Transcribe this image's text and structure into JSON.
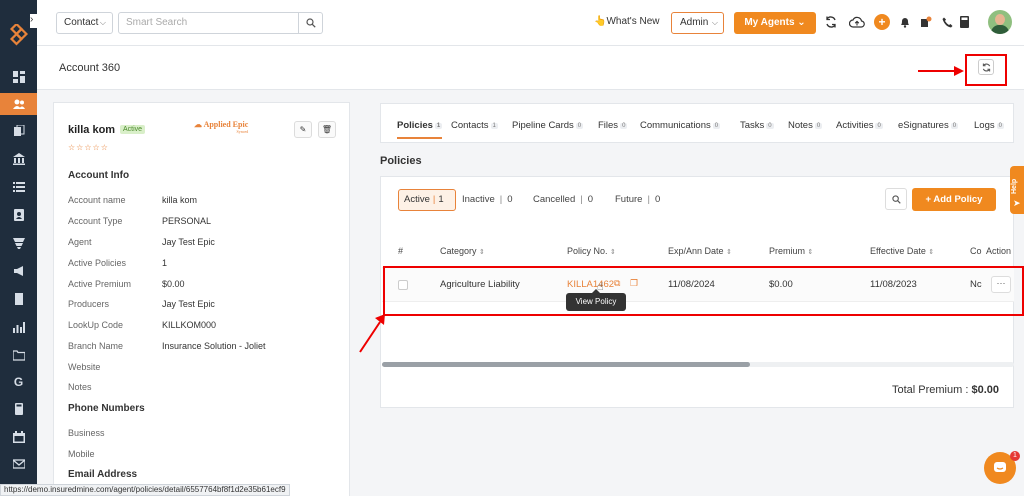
{
  "topbar": {
    "contact_select": "Contact",
    "search_placeholder": "Smart Search",
    "whats_new": "What's New",
    "admin_select": "Admin",
    "agents_button": "My Agents"
  },
  "page": {
    "title": "Account 360"
  },
  "account": {
    "name": "killa kom",
    "status": "Active",
    "integration_logo": "Applied Epic",
    "integration_sub": "Synced",
    "account_info_heading": "Account Info",
    "fields": [
      {
        "label": "Account name",
        "value": "killa kom"
      },
      {
        "label": "Account Type",
        "value": "PERSONAL"
      },
      {
        "label": "Agent",
        "value": "Jay Test Epic"
      },
      {
        "label": "Active Policies",
        "value": "1"
      },
      {
        "label": "Active Premium",
        "value": "$0.00"
      },
      {
        "label": "Producers",
        "value": "Jay Test Epic"
      },
      {
        "label": "LookUp Code",
        "value": "KILLKOM000"
      },
      {
        "label": "Branch Name",
        "value": "Insurance Solution - Joliet"
      },
      {
        "label": "Website",
        "value": ""
      },
      {
        "label": "Notes",
        "value": ""
      }
    ],
    "phone_heading": "Phone Numbers",
    "phone_fields": [
      {
        "label": "Business",
        "value": ""
      },
      {
        "label": "Mobile",
        "value": ""
      }
    ],
    "email_heading": "Email Address"
  },
  "tabs": [
    {
      "label": "Policies",
      "count": "1"
    },
    {
      "label": "Contacts",
      "count": "1"
    },
    {
      "label": "Pipeline Cards",
      "count": "0"
    },
    {
      "label": "Files",
      "count": "0"
    },
    {
      "label": "Communications",
      "count": "0"
    },
    {
      "label": "Tasks",
      "count": "0"
    },
    {
      "label": "Notes",
      "count": "0"
    },
    {
      "label": "Activities",
      "count": "0"
    },
    {
      "label": "eSignatures",
      "count": "0"
    },
    {
      "label": "Logs",
      "count": "0"
    }
  ],
  "policies": {
    "section_title": "Policies",
    "filters": [
      {
        "label": "Active",
        "count": "1"
      },
      {
        "label": "Inactive",
        "count": "0"
      },
      {
        "label": "Cancelled",
        "count": "0"
      },
      {
        "label": "Future",
        "count": "0"
      }
    ],
    "add_button": "+ Add Policy",
    "columns": [
      "#",
      "Category",
      "Policy No.",
      "Exp/Ann Date",
      "Premium",
      "Effective Date",
      "Co",
      "Action"
    ],
    "rows": [
      {
        "category": "Agriculture Liability",
        "policy_no": "KILLA1462",
        "exp_date": "11/08/2024",
        "premium": "$0.00",
        "effective_date": "11/08/2023",
        "co": "Nc",
        "action": "···"
      }
    ],
    "tooltip": "View Policy",
    "total_label": "Total Premium :",
    "total_value": "$0.00"
  },
  "help": {
    "label": "Help",
    "chat_badge": "1"
  },
  "status_url": "https://demo.insuredmine.com/agent/policies/detail/6557764bf8f1d2e35b61ecf9",
  "colors": {
    "accent": "#f0891f",
    "sidebar": "#1f2d3d",
    "annotation": "#e00000"
  }
}
